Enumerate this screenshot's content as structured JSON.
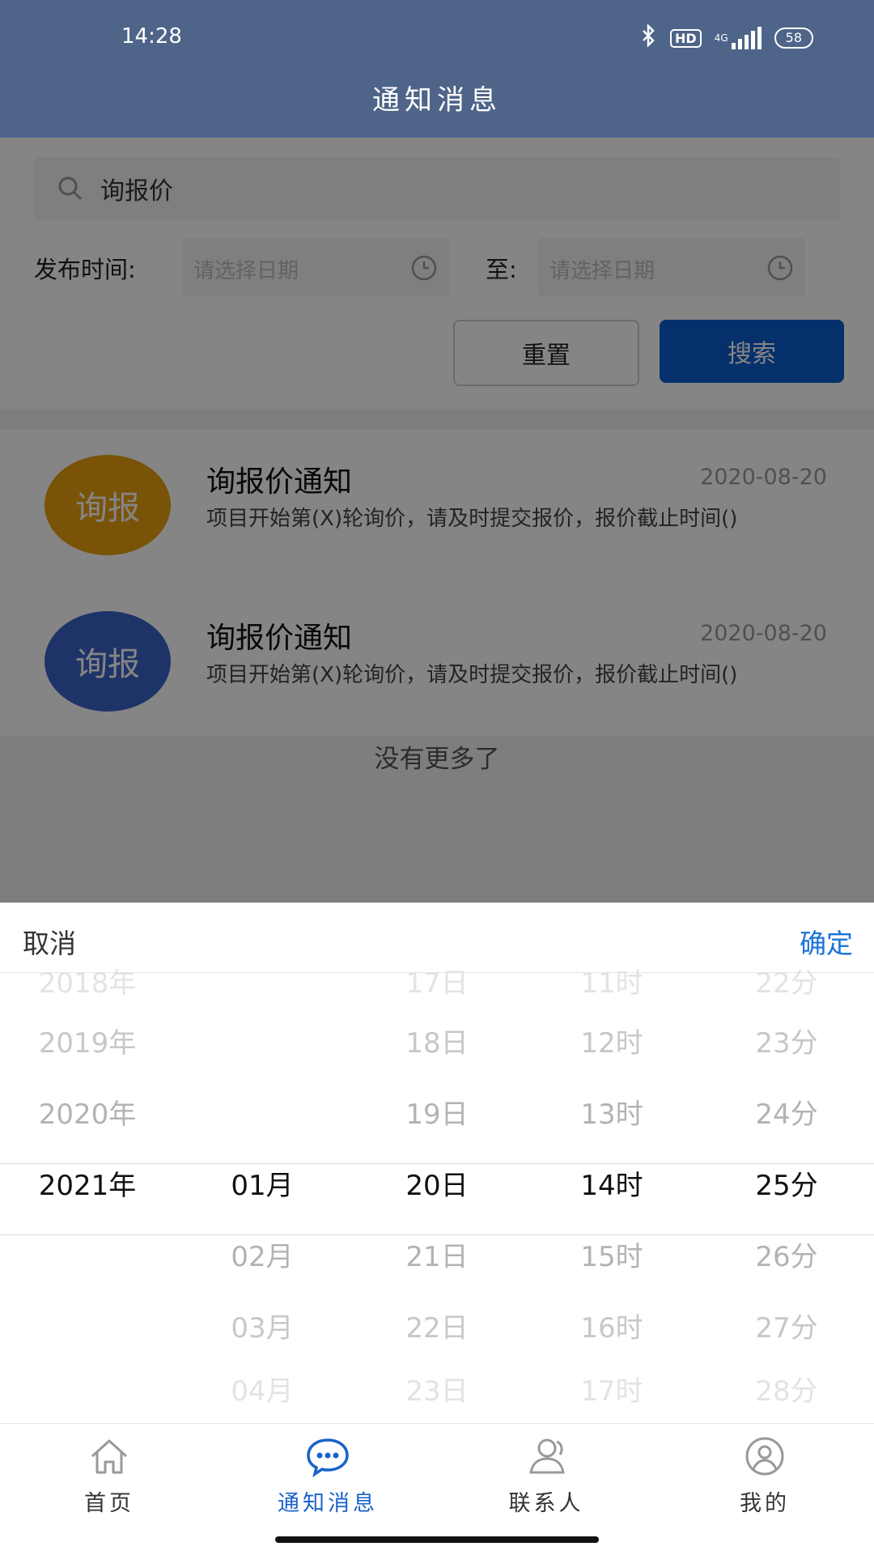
{
  "status": {
    "time": "14:28",
    "hd": "HD",
    "network": "4G",
    "battery": "58"
  },
  "header": {
    "title": "通知消息"
  },
  "search": {
    "value": "询报价"
  },
  "date_filter": {
    "label": "发布时间:",
    "start_placeholder": "请选择日期",
    "to_label": "至:",
    "end_placeholder": "请选择日期"
  },
  "buttons": {
    "reset": "重置",
    "search": "搜索"
  },
  "notifications": [
    {
      "avatar_text": "询报",
      "avatar_color": "#e8a010",
      "title": "询报价通知",
      "date": "2020-08-20",
      "desc": "项目开始第(X)轮询价，请及时提交报价，报价截止时间()"
    },
    {
      "avatar_text": "询报",
      "avatar_color": "#3a63c8",
      "title": "询报价通知",
      "date": "2020-08-20",
      "desc": "项目开始第(X)轮询价，请及时提交报价，报价截止时间()"
    }
  ],
  "list_footer": "没有更多了",
  "picker": {
    "cancel": "取消",
    "confirm": "确定",
    "columns": [
      {
        "name": "year",
        "items": [
          "2018年",
          "2019年",
          "2020年",
          "2021年",
          "",
          "",
          ""
        ]
      },
      {
        "name": "month",
        "items": [
          "",
          "",
          "",
          "01月",
          "02月",
          "03月",
          "04月"
        ]
      },
      {
        "name": "day",
        "items": [
          "17日",
          "18日",
          "19日",
          "20日",
          "21日",
          "22日",
          "23日"
        ]
      },
      {
        "name": "hour",
        "items": [
          "11时",
          "12时",
          "13时",
          "14时",
          "15时",
          "16时",
          "17时"
        ]
      },
      {
        "name": "minute",
        "items": [
          "22分",
          "23分",
          "24分",
          "25分",
          "26分",
          "27分",
          "28分"
        ]
      }
    ],
    "selected": {
      "year": "2021年",
      "month": "01月",
      "day": "20日",
      "hour": "14时",
      "minute": "25分"
    }
  },
  "nav": [
    {
      "label": "首页",
      "icon": "home-icon",
      "active": false
    },
    {
      "label": "通知消息",
      "icon": "message-icon",
      "active": true
    },
    {
      "label": "联系人",
      "icon": "contacts-icon",
      "active": false
    },
    {
      "label": "我的",
      "icon": "profile-icon",
      "active": false
    }
  ],
  "colors": {
    "header": "#4e6489",
    "accent": "#1a73d9",
    "primary_button": "#0a5ccd"
  }
}
